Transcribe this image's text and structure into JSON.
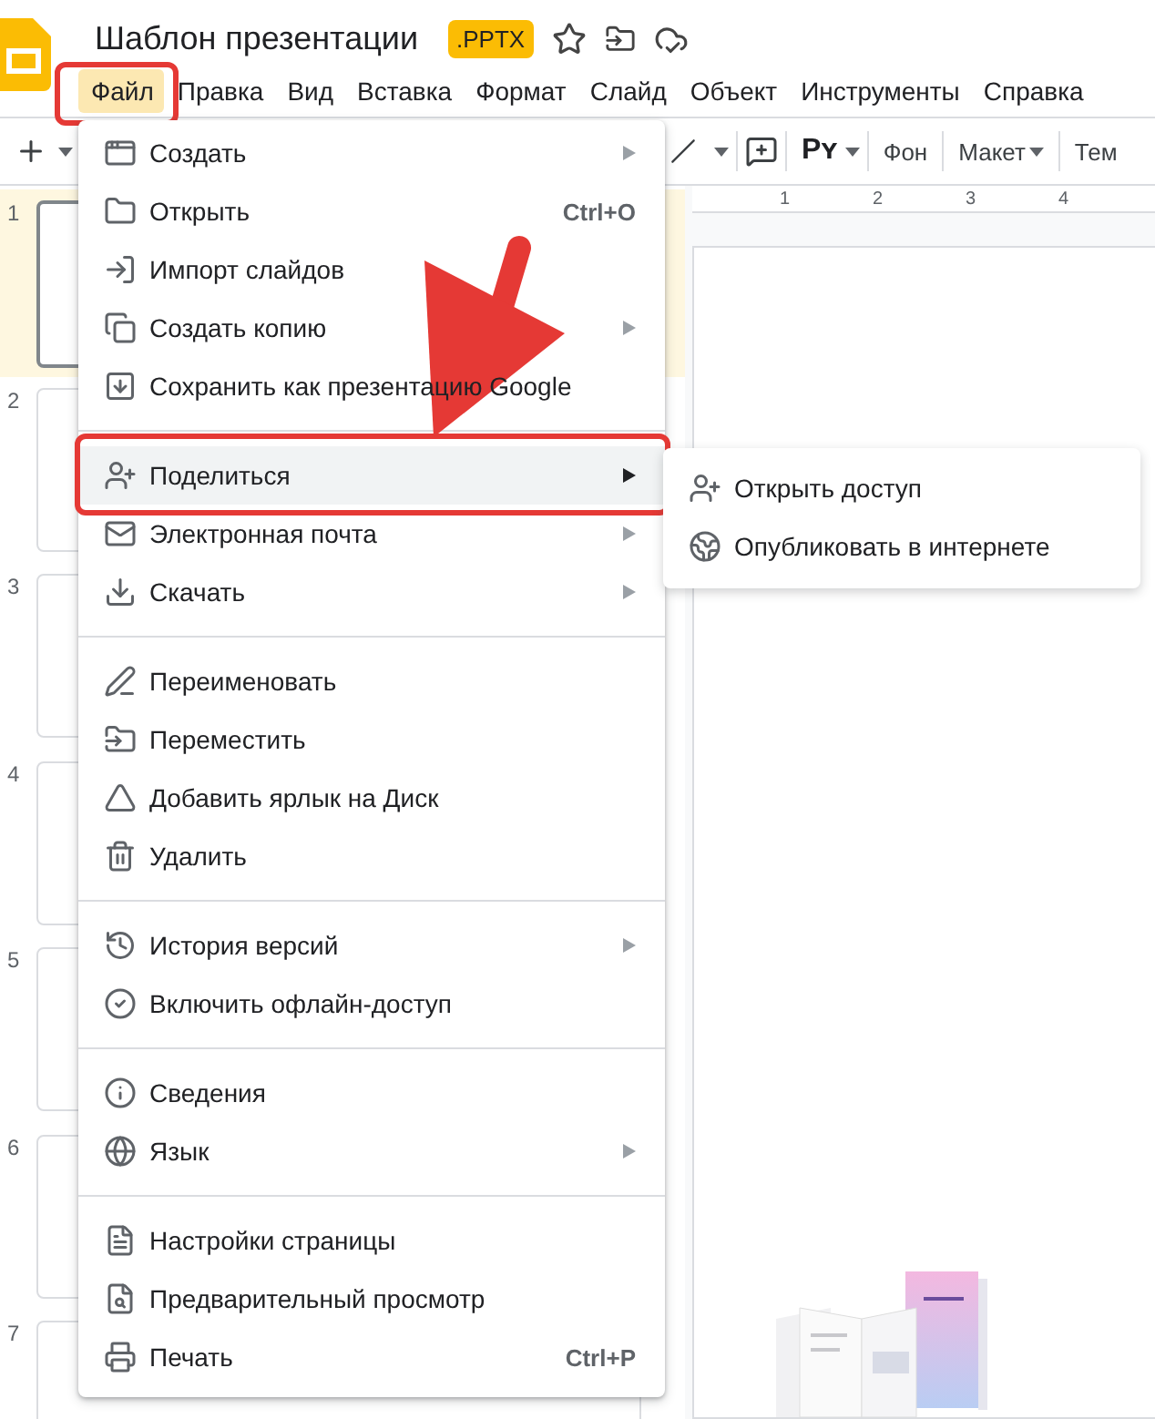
{
  "header": {
    "title": "Шаблон презентации",
    "badge": ".PPTX"
  },
  "menubar": [
    {
      "label": "Файл",
      "selected": true
    },
    {
      "label": "Правка",
      "selected": false
    },
    {
      "label": "Вид",
      "selected": false
    },
    {
      "label": "Вставка",
      "selected": false
    },
    {
      "label": "Формат",
      "selected": false
    },
    {
      "label": "Слайд",
      "selected": false
    },
    {
      "label": "Объект",
      "selected": false
    },
    {
      "label": "Инструменты",
      "selected": false
    },
    {
      "label": "Справка",
      "selected": false
    }
  ],
  "toolbar": {
    "style_label": "Pʏ",
    "buttons": [
      {
        "label": "Фон",
        "caret": false
      },
      {
        "label": "Макет",
        "caret": true
      },
      {
        "label": "Тем",
        "caret": false
      }
    ]
  },
  "ruler": [
    "1",
    "2",
    "3",
    "4"
  ],
  "slides": [
    {
      "number": "1",
      "selected": true
    },
    {
      "number": "2",
      "selected": false
    },
    {
      "number": "3",
      "selected": false
    },
    {
      "number": "4",
      "selected": false
    },
    {
      "number": "5",
      "selected": false
    },
    {
      "number": "6",
      "selected": false
    },
    {
      "number": "7",
      "selected": false
    }
  ],
  "file_menu": [
    [
      {
        "label": "Создать",
        "has_submenu": true,
        "highlighted": false
      },
      {
        "label": "Открыть",
        "shortcut": "Ctrl+O",
        "has_submenu": false,
        "highlighted": false
      },
      {
        "label": "Импорт слайдов",
        "has_submenu": false,
        "highlighted": false
      },
      {
        "label": "Создать копию",
        "has_submenu": true,
        "highlighted": false
      },
      {
        "label": "Сохранить как презентацию Google",
        "has_submenu": false,
        "highlighted": false
      }
    ],
    [
      {
        "label": "Поделиться",
        "has_submenu": true,
        "highlighted": true
      },
      {
        "label": "Электронная почта",
        "has_submenu": true,
        "highlighted": false
      },
      {
        "label": "Скачать",
        "has_submenu": true,
        "highlighted": false
      }
    ],
    [
      {
        "label": "Переименовать",
        "has_submenu": false,
        "highlighted": false
      },
      {
        "label": "Переместить",
        "has_submenu": false,
        "highlighted": false
      },
      {
        "label": "Добавить ярлык на Диск",
        "has_submenu": false,
        "highlighted": false
      },
      {
        "label": "Удалить",
        "has_submenu": false,
        "highlighted": false
      }
    ],
    [
      {
        "label": "История версий",
        "has_submenu": true,
        "highlighted": false
      },
      {
        "label": "Включить офлайн-доступ",
        "has_submenu": false,
        "highlighted": false
      }
    ],
    [
      {
        "label": "Сведения",
        "has_submenu": false,
        "highlighted": false
      },
      {
        "label": "Язык",
        "has_submenu": true,
        "highlighted": false
      }
    ],
    [
      {
        "label": "Настройки страницы",
        "has_submenu": false,
        "highlighted": false
      },
      {
        "label": "Предварительный просмотр",
        "has_submenu": false,
        "highlighted": false
      },
      {
        "label": "Печать",
        "shortcut": "Ctrl+P",
        "has_submenu": false,
        "highlighted": false
      }
    ]
  ],
  "share_submenu": [
    {
      "label": "Открыть доступ"
    },
    {
      "label": "Опубликовать в интернете"
    }
  ]
}
